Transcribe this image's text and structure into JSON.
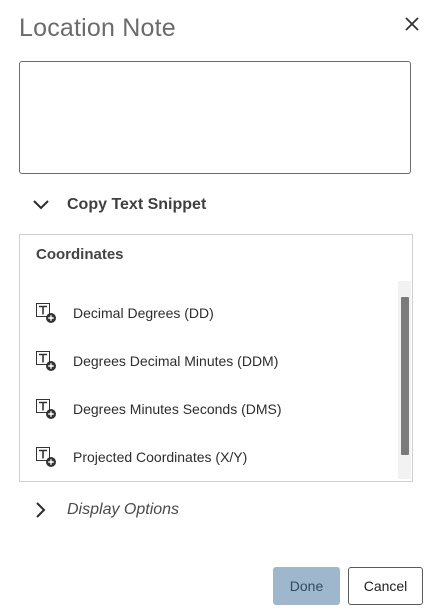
{
  "dialog": {
    "title": "Location Note",
    "note_value": "",
    "copy_section": {
      "label": "Copy Text Snippet",
      "expanded": true
    },
    "coordinates": {
      "title": "Coordinates",
      "items": [
        {
          "label": "Decimal Degrees (DD)",
          "icon": "text-add-icon"
        },
        {
          "label": "Degrees Decimal Minutes (DDM)",
          "icon": "text-add-icon"
        },
        {
          "label": "Degrees Minutes Seconds (DMS)",
          "icon": "text-add-icon"
        },
        {
          "label": "Projected Coordinates (X/Y)",
          "icon": "text-add-icon"
        }
      ]
    },
    "display_section": {
      "label": "Display Options",
      "expanded": false
    },
    "buttons": {
      "done": "Done",
      "cancel": "Cancel"
    }
  },
  "colors": {
    "done_bg": "#9fb7cc",
    "scroll_thumb": "#7b7b7b"
  }
}
